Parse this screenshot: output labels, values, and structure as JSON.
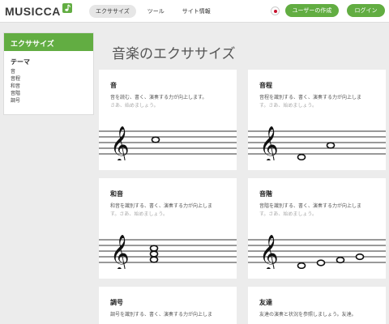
{
  "header": {
    "logo": "MUSICCA",
    "nav": [
      "エクササイズ",
      "ツール",
      "サイト情報"
    ],
    "create_user": "ユーザーの作成",
    "login": "ログイン"
  },
  "sidebar": {
    "title": "エクササイズ",
    "group": "テーマ",
    "items": [
      "音",
      "音程",
      "和音",
      "音階",
      "調号"
    ]
  },
  "main": {
    "title": "音楽のエクササイズ",
    "cards": [
      {
        "title": "音",
        "desc": "音を読む、書く、演奏する力が向上します。",
        "sub": "さあ、始めましょう。"
      },
      {
        "title": "音程",
        "desc": "音程を識別する、書く、演奏する力が向上しま",
        "sub": "す。さあ、始めましょう。"
      },
      {
        "title": "和音",
        "desc": "和音を識別する、書く、演奏する力が向上しま",
        "sub": "す。さあ、始めましょう。"
      },
      {
        "title": "音階",
        "desc": "音階を識別する、書く、演奏する力が向上しま",
        "sub": "す。さあ、始めましょう。"
      },
      {
        "title": "調号",
        "desc": "調号を識別する、書く、演奏する力が向上しま",
        "sub": ""
      },
      {
        "title": "友達",
        "desc": "友達の演奏と状況を参照しましょう。友達。",
        "sub": ""
      }
    ]
  },
  "colors": {
    "green": "#62ad42",
    "background": "#ececec"
  },
  "icons": {
    "logo_note": "music-note-icon",
    "language": "japan-flag-icon",
    "clef": "treble-clef-icon"
  }
}
